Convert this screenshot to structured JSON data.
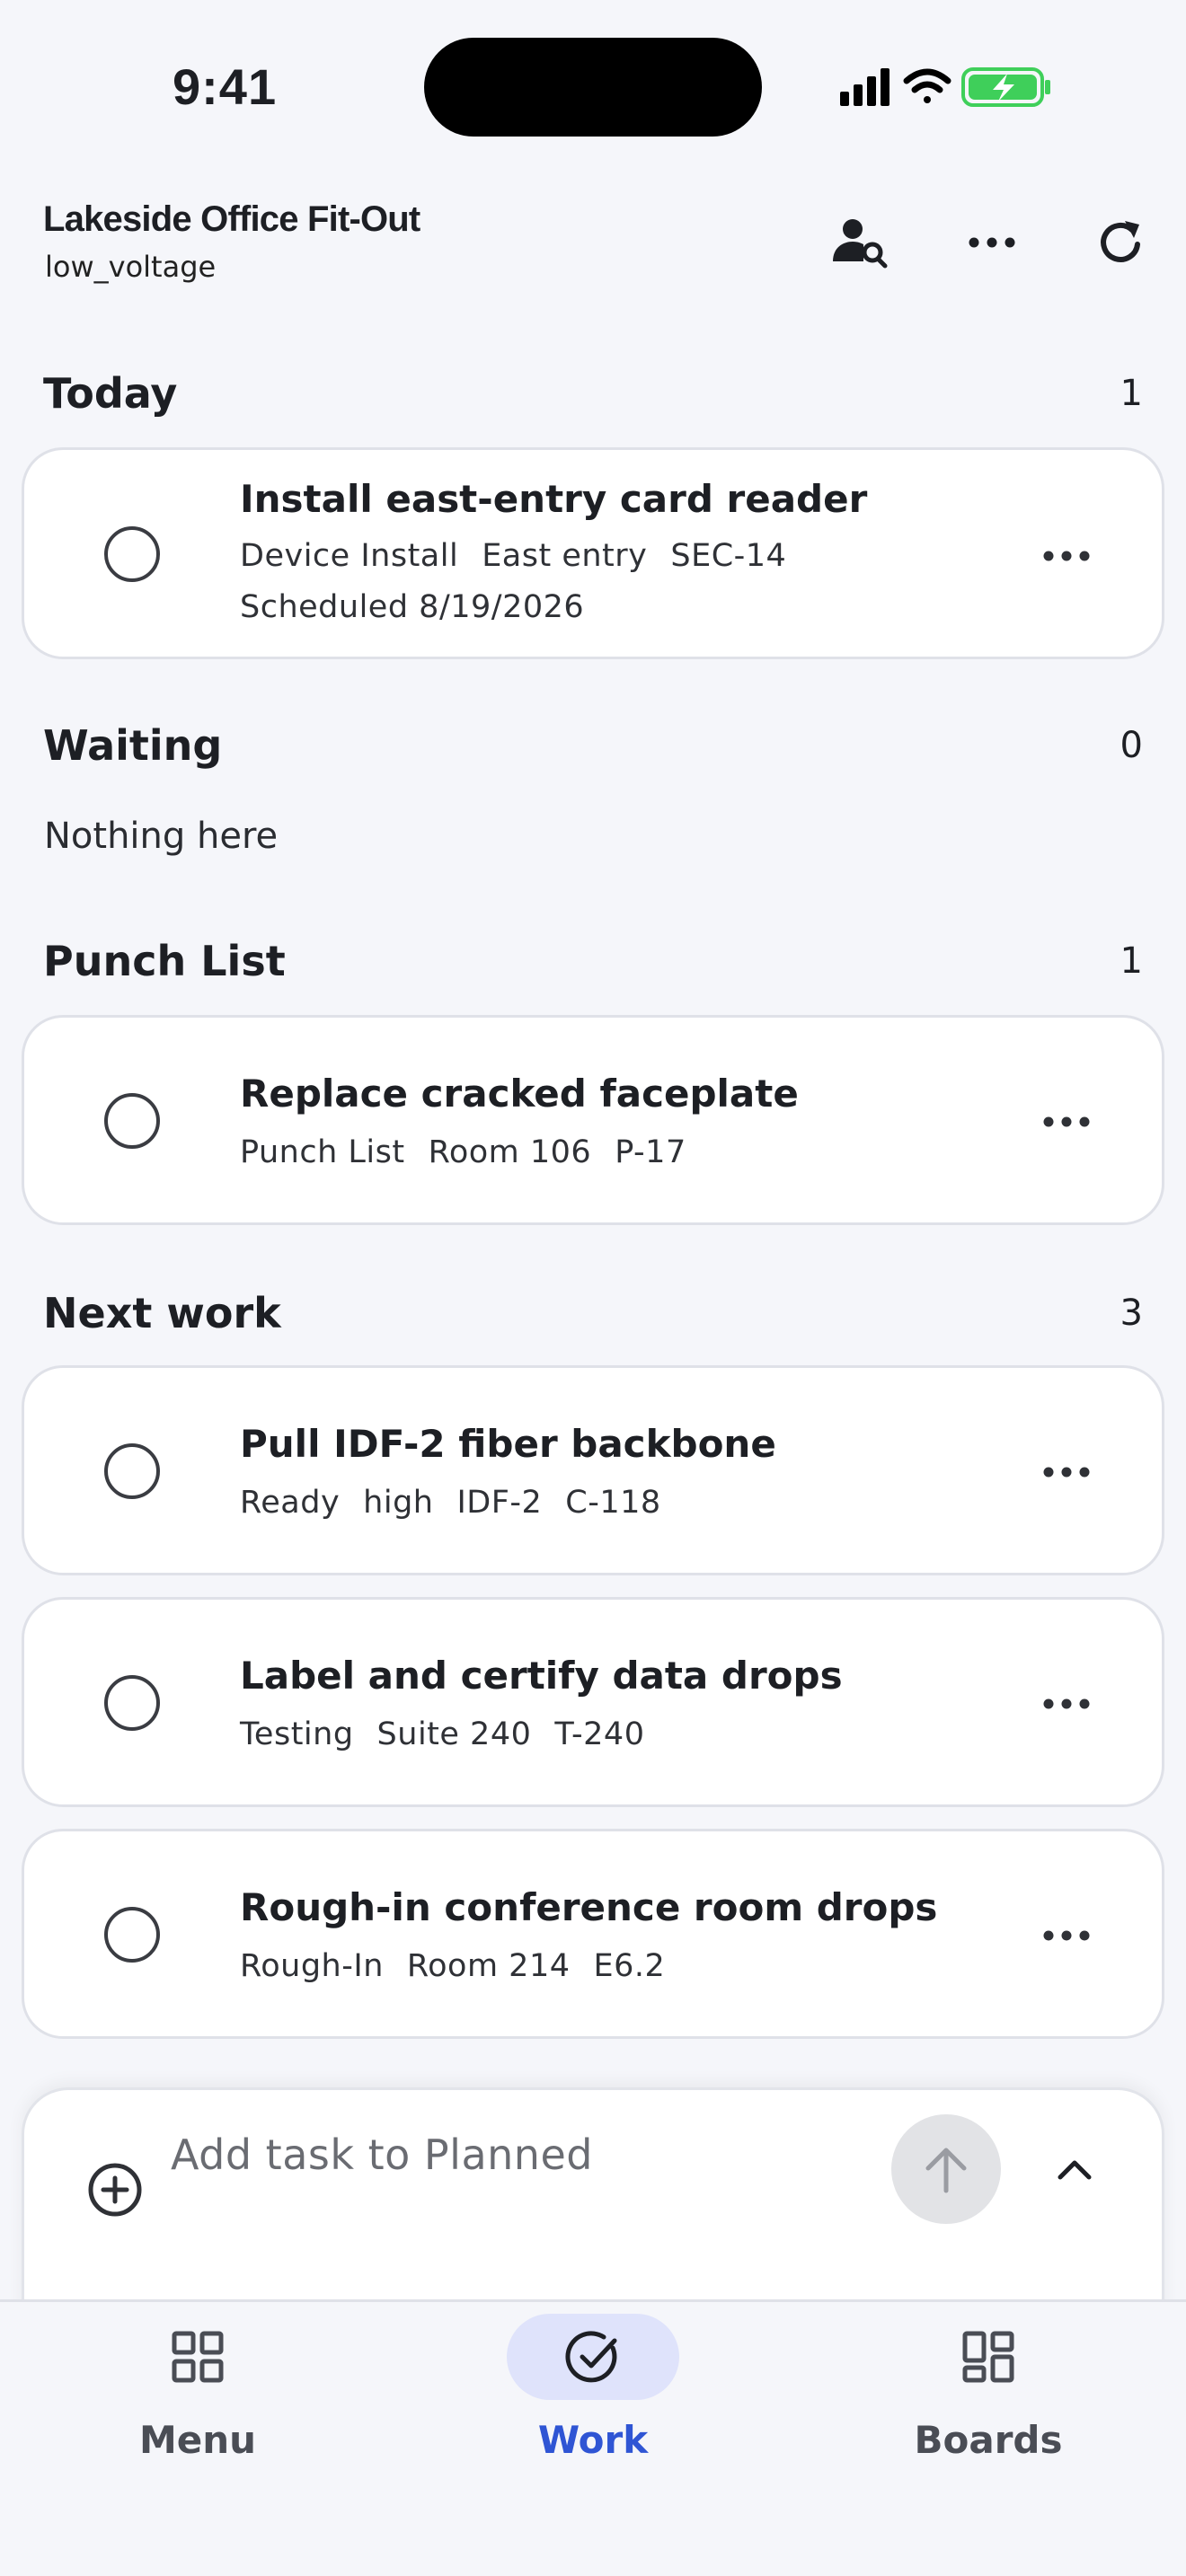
{
  "status_bar": {
    "time": "9:41"
  },
  "header": {
    "title": "Lakeside Office Fit-Out",
    "subtitle": "low_voltage",
    "icons": [
      "person-search-icon",
      "more-horizontal-icon",
      "refresh-icon"
    ]
  },
  "sections": {
    "today": {
      "title": "Today",
      "count": "1",
      "tasks": [
        {
          "title": "Install east-entry card reader",
          "meta": [
            "Device Install",
            "East entry",
            "SEC-14"
          ],
          "scheduled": "Scheduled 8/19/2026"
        }
      ]
    },
    "waiting": {
      "title": "Waiting",
      "count": "0",
      "empty": "Nothing here"
    },
    "punch": {
      "title": "Punch List",
      "count": "1",
      "tasks": [
        {
          "title": "Replace cracked faceplate",
          "meta": [
            "Punch List",
            "Room 106",
            "P-17"
          ]
        }
      ]
    },
    "next": {
      "title": "Next work",
      "count": "3",
      "tasks": [
        {
          "title": "Pull IDF-2 fiber backbone",
          "meta": [
            "Ready",
            "high",
            "IDF-2",
            "C-118"
          ]
        },
        {
          "title": "Label and certify data drops",
          "meta": [
            "Testing",
            "Suite 240",
            "T-240"
          ]
        },
        {
          "title": "Rough-in conference room drops",
          "meta": [
            "Rough-In",
            "Room 214",
            "E6.2"
          ]
        }
      ]
    }
  },
  "composer": {
    "placeholder": "Add task to Planned"
  },
  "nav": {
    "items": [
      {
        "label": "Menu",
        "icon": "grid-icon"
      },
      {
        "label": "Work",
        "icon": "check-circle-icon",
        "active": true
      },
      {
        "label": "Boards",
        "icon": "dashboard-icon"
      }
    ]
  },
  "colors": {
    "accent": "#2f55d4",
    "accent_pill": "#dfe3fb",
    "background": "#f5f6fa",
    "card_border": "#dfe1e8",
    "battery_green": "#3fcf5a"
  }
}
